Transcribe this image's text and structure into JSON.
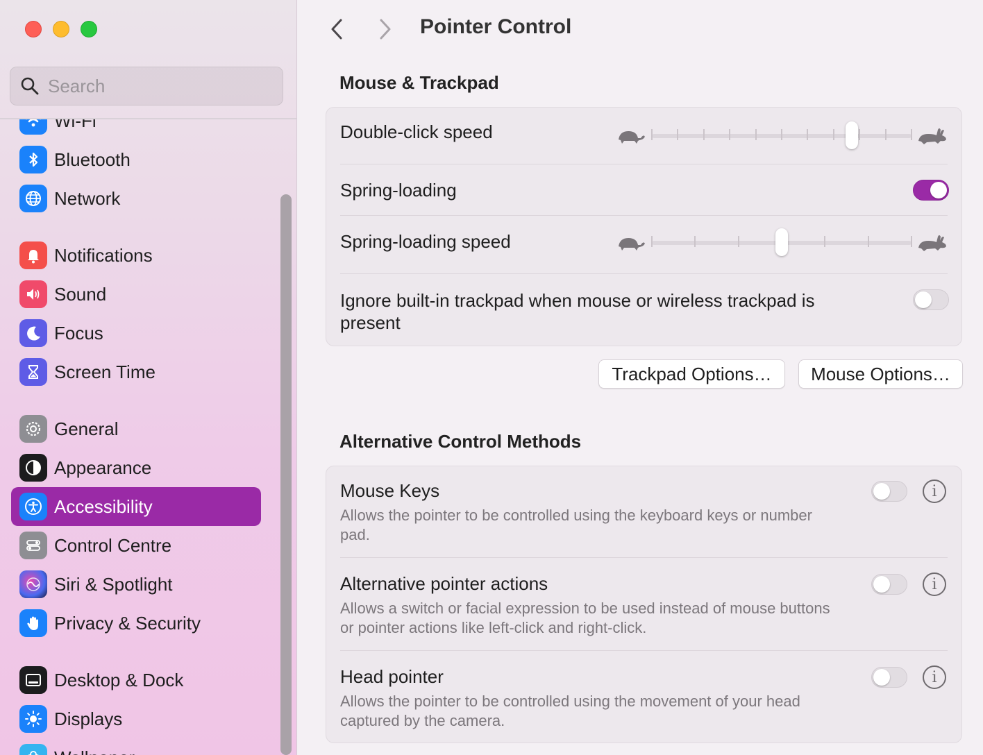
{
  "window": {
    "title": "Pointer Control"
  },
  "search": {
    "placeholder": "Search"
  },
  "sidebar": {
    "items": [
      {
        "label": "Wi-Fi",
        "icon": "wifi-icon",
        "color": "#1a82fb"
      },
      {
        "label": "Bluetooth",
        "icon": "bluetooth-icon",
        "color": "#1a82fb"
      },
      {
        "label": "Network",
        "icon": "globe-icon",
        "color": "#1a82fb"
      },
      {
        "label": "Notifications",
        "icon": "bell-icon",
        "color": "#f44f4a"
      },
      {
        "label": "Sound",
        "icon": "speaker-icon",
        "color": "#f04a6a"
      },
      {
        "label": "Focus",
        "icon": "moon-icon",
        "color": "#5e5ce6"
      },
      {
        "label": "Screen Time",
        "icon": "hourglass-icon",
        "color": "#5e5ce6"
      },
      {
        "label": "General",
        "icon": "gear-icon",
        "color": "#8e8e93"
      },
      {
        "label": "Appearance",
        "icon": "appearance-icon",
        "color": "#1c1c1e"
      },
      {
        "label": "Accessibility",
        "icon": "accessibility-icon",
        "color": "#1a82fb"
      },
      {
        "label": "Control Centre",
        "icon": "control-centre-icon",
        "color": "#8e8e93"
      },
      {
        "label": "Siri & Spotlight",
        "icon": "siri-icon",
        "color": "#2a2a5a"
      },
      {
        "label": "Privacy & Security",
        "icon": "hand-icon",
        "color": "#1a82fb"
      },
      {
        "label": "Desktop & Dock",
        "icon": "dock-icon",
        "color": "#1c1c1e"
      },
      {
        "label": "Displays",
        "icon": "sun-icon",
        "color": "#1a82fb"
      },
      {
        "label": "Wallpaper",
        "icon": "flower-icon",
        "color": "#35b4f0"
      }
    ],
    "active": "Accessibility"
  },
  "mouse_trackpad": {
    "heading": "Mouse & Trackpad",
    "double_click": {
      "label": "Double-click speed",
      "value": 0.77,
      "ticks": 11
    },
    "spring_loading": {
      "label": "Spring-loading",
      "on": true
    },
    "spring_speed": {
      "label": "Spring-loading speed",
      "value": 0.5,
      "ticks": 7
    },
    "ignore_trackpad": {
      "label": "Ignore built-in trackpad when mouse or wireless trackpad is present",
      "on": false
    }
  },
  "buttons": {
    "trackpad_options": "Trackpad Options…",
    "mouse_options": "Mouse Options…"
  },
  "alternative": {
    "heading": "Alternative Control Methods",
    "mouse_keys": {
      "label": "Mouse Keys",
      "desc": "Allows the pointer to be controlled using the keyboard keys or number pad.",
      "on": false
    },
    "alt_pointer": {
      "label": "Alternative pointer actions",
      "desc": "Allows a switch or facial expression to be used instead of mouse buttons or pointer actions like left-click and right-click.",
      "on": false
    },
    "head_pointer": {
      "label": "Head pointer",
      "desc": "Allows the pointer to be controlled using the movement of your head captured by the camera.",
      "on": false
    }
  },
  "colors": {
    "accent": "#9a2aa6"
  }
}
